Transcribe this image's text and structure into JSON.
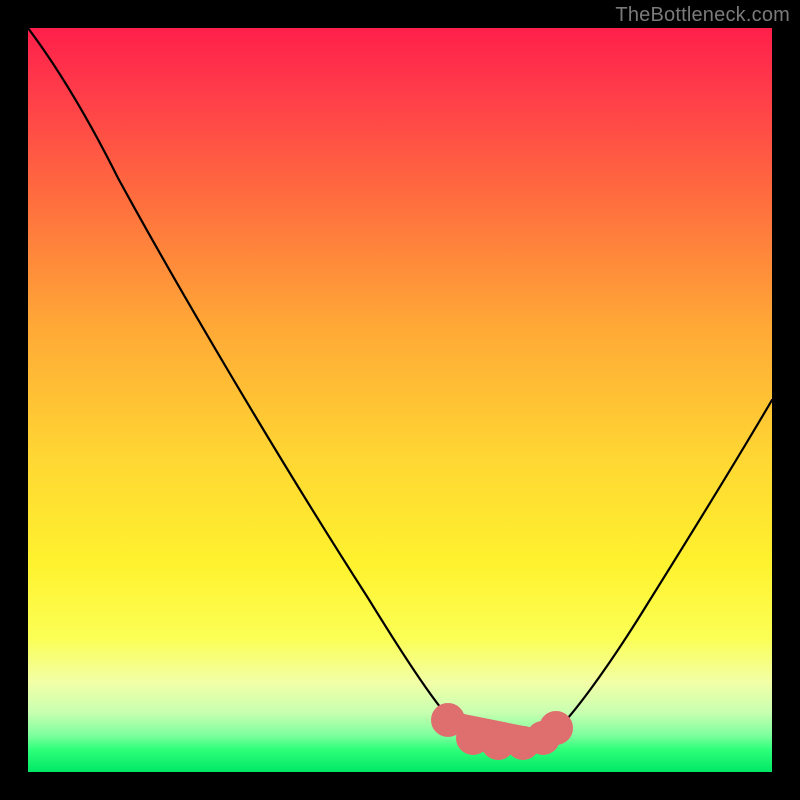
{
  "watermark": "TheBottleneck.com",
  "chart_data": {
    "type": "line",
    "title": "",
    "xlabel": "",
    "ylabel": "",
    "xlim": [
      0,
      100
    ],
    "ylim": [
      0,
      100
    ],
    "grid": false,
    "legend": false,
    "series": [
      {
        "name": "curve",
        "color": "#000000",
        "x": [
          0,
          5,
          15,
          25,
          35,
          45,
          52,
          56,
          58,
          60,
          62,
          65,
          68,
          70,
          75,
          82,
          90,
          100
        ],
        "values": [
          100,
          94,
          80,
          66,
          51,
          35,
          21,
          11,
          7,
          5,
          4,
          4,
          4,
          5,
          9,
          18,
          31,
          50
        ]
      },
      {
        "name": "valley-markers",
        "color": "#e06a6a",
        "type": "scatter",
        "x": [
          56,
          58,
          60,
          62,
          65,
          68,
          70
        ],
        "values": [
          7,
          5,
          4,
          4,
          4,
          4,
          5
        ]
      }
    ],
    "background_gradient": {
      "top": "#ff1f4a",
      "bottom": "#00e765",
      "stops": [
        "red",
        "orange",
        "yellow",
        "green"
      ]
    }
  }
}
